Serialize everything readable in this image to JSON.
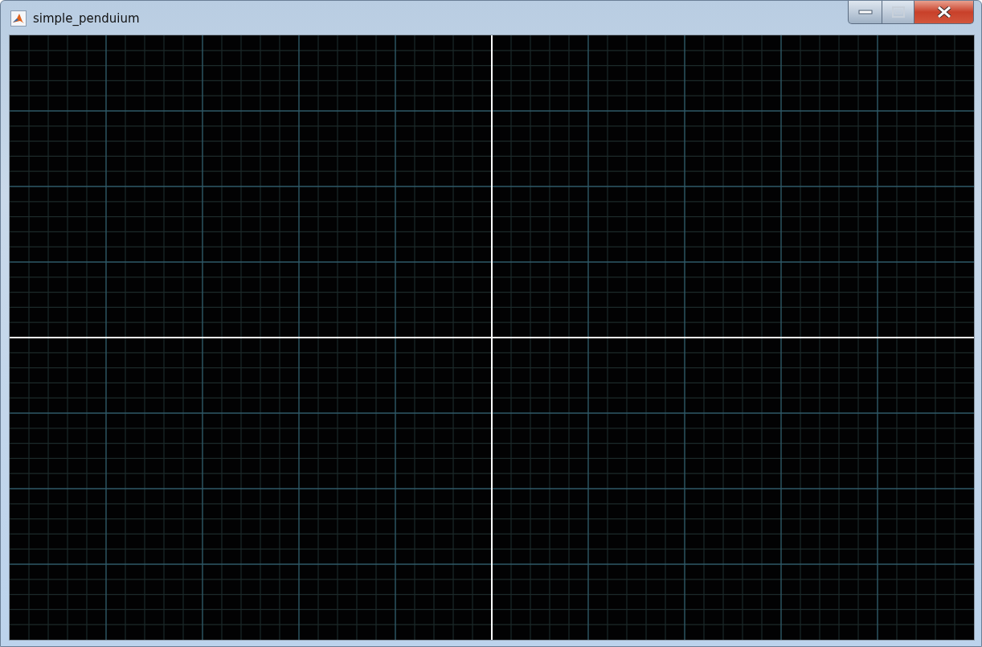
{
  "window": {
    "title": "simple_penduium",
    "controls": [
      {
        "kind": "minimize"
      },
      {
        "kind": "maximize"
      },
      {
        "kind": "close"
      }
    ]
  }
}
